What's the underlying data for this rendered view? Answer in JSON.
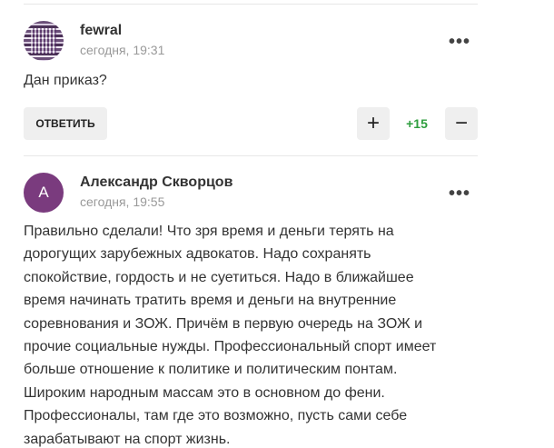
{
  "comments": [
    {
      "author": "fewral",
      "time": "сегодня, 19:31",
      "text": "Дан приказ?",
      "reply_label": "ОТВЕТИТЬ",
      "score": "+15",
      "plus_label": "+",
      "minus_label": "−",
      "more_label": "•••"
    },
    {
      "author": "Александр Скворцов",
      "avatar_letter": "А",
      "time": "сегодня, 19:55",
      "more_label": "•••",
      "text_lines": [
        "Правильно сделали! Что зря время и деньги терять на",
        "дорогущих зарубежных адвокатов. Надо сохранять",
        "спокойствие, гордость и не суетиться. Надо в ближайшее",
        "время начинать тратить время и деньги на внутренние",
        "соревнования и ЗОЖ. Причём в первую очередь на ЗОЖ и",
        "прочие социальные нужды. Профессиональный спорт имеет",
        "больше отношение к политике и политическим понтам.",
        "Широким народным массам это в основном до фени.",
        "Профессионалы, там где это возможно, пусть сами себе",
        "зарабатывают на спорт жизнь."
      ]
    }
  ],
  "colors": {
    "score_positive": "#2e9e3e",
    "avatar_bg": "#7a3b7e",
    "button_bg": "#efefef"
  }
}
